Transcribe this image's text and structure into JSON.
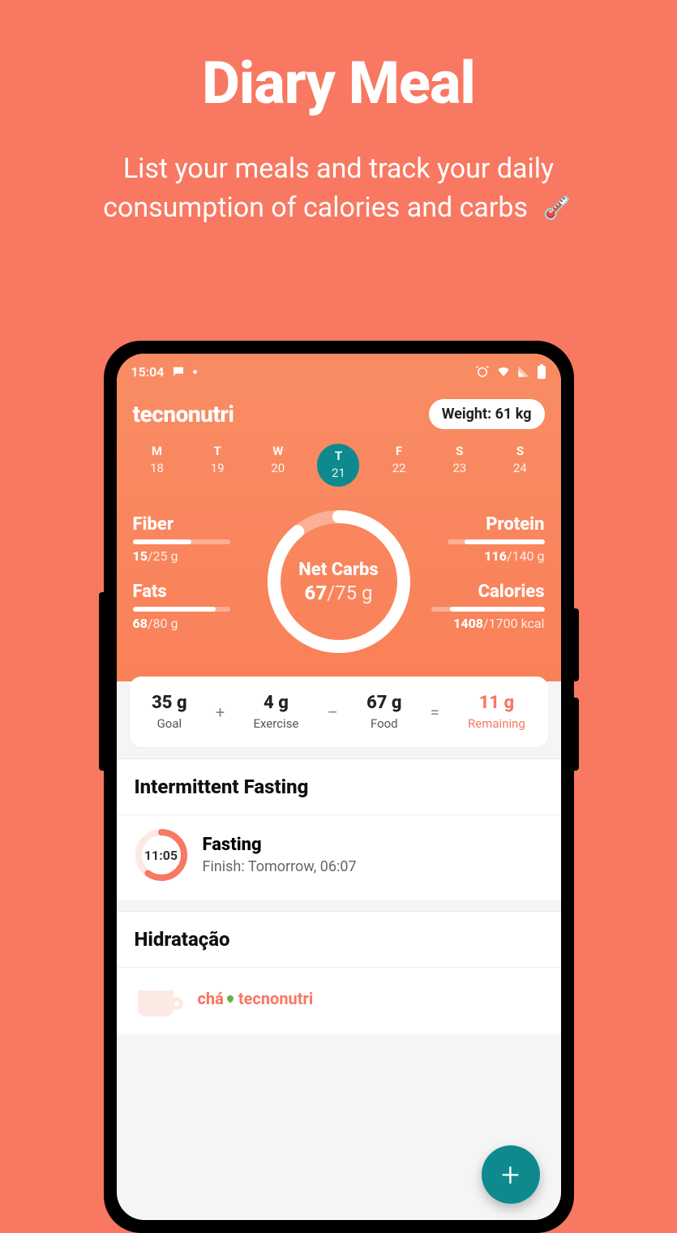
{
  "hero": {
    "title": "Diary Meal",
    "subtitle": "List your meals and track your daily consumption of calories and carbs",
    "emoji": "🌡️"
  },
  "statusbar": {
    "time": "15:04"
  },
  "header": {
    "brand": "tecnonutri",
    "weight_label": "Weight: 61 kg",
    "days": [
      {
        "label": "M",
        "num": "18",
        "selected": false
      },
      {
        "label": "T",
        "num": "19",
        "selected": false
      },
      {
        "label": "W",
        "num": "20",
        "selected": false
      },
      {
        "label": "T",
        "num": "21",
        "selected": true
      },
      {
        "label": "F",
        "num": "22",
        "selected": false
      },
      {
        "label": "S",
        "num": "23",
        "selected": false
      },
      {
        "label": "S",
        "num": "24",
        "selected": false
      }
    ]
  },
  "macros": {
    "fiber": {
      "name": "Fiber",
      "cur": "15",
      "tot": "/25 g",
      "pct": 60
    },
    "fats": {
      "name": "Fats",
      "cur": "68",
      "tot": "/80 g",
      "pct": 85
    },
    "protein": {
      "name": "Protein",
      "cur": "116",
      "tot": "/140 g",
      "pct": 82
    },
    "calories": {
      "name": "Calories",
      "cur": "1408",
      "tot": "/1700 kcal",
      "pct": 83
    },
    "center": {
      "title": "Net Carbs",
      "cur": "67",
      "tot": "/75 g",
      "pct": 89
    }
  },
  "summary": {
    "goal": {
      "v": "35 g",
      "l": "Goal"
    },
    "exercise": {
      "v": "4 g",
      "l": "Exercise"
    },
    "food": {
      "v": "67 g",
      "l": "Food"
    },
    "remaining": {
      "v": "11 g",
      "l": "Remaining"
    },
    "op_plus": "+",
    "op_minus": "–",
    "op_eq": "="
  },
  "fasting": {
    "section_title": "Intermittent Fasting",
    "timer": "11:05",
    "title": "Fasting",
    "subtitle": "Finish: Tomorrow, 06:07",
    "ring_pct": 60
  },
  "hydration": {
    "section_title": "Hidratação",
    "brand1": "chá",
    "brand2": "tecnonutri"
  },
  "fab": {
    "label": "+"
  }
}
